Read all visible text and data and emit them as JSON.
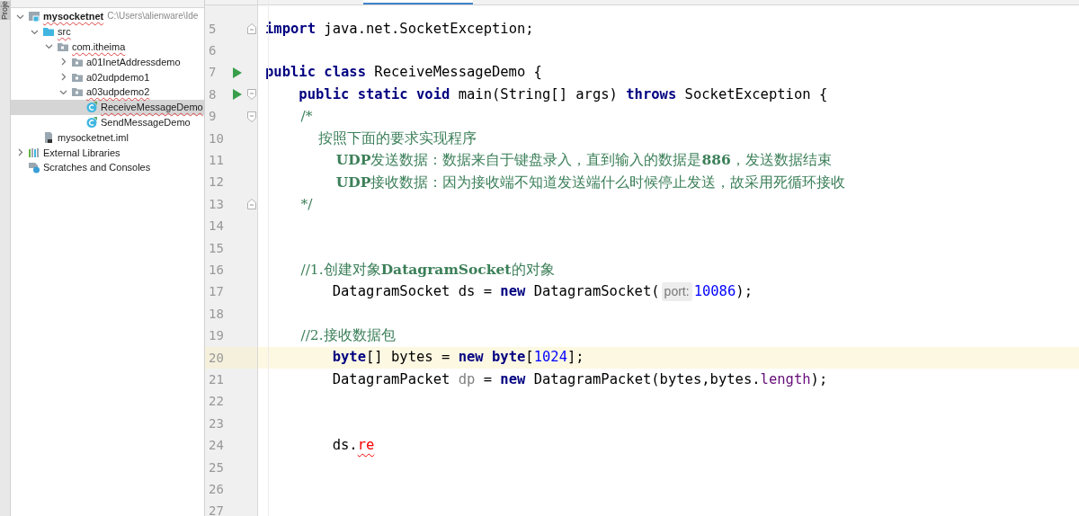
{
  "tool_window_stripe": {
    "label": "Proje"
  },
  "project_panel": {
    "tree": [
      {
        "label": "mysocketnet",
        "detail": "C:\\Users\\alienware\\Ide",
        "kind": "module",
        "expanded": true,
        "selected": false,
        "misspelled": true,
        "children": [
          {
            "label": "src",
            "kind": "source",
            "expanded": true,
            "selected": false,
            "misspelled": true,
            "children": [
              {
                "label": "com.itheima",
                "kind": "package",
                "expanded": true,
                "selected": false,
                "misspelled": true,
                "children": [
                  {
                    "label": "a01InetAddressdemo",
                    "kind": "package",
                    "expanded": false,
                    "selected": false,
                    "misspelled": false
                  },
                  {
                    "label": "a02udpdemo1",
                    "kind": "package",
                    "expanded": false,
                    "selected": false,
                    "misspelled": false
                  },
                  {
                    "label": "a03udpdemo2",
                    "kind": "package",
                    "expanded": true,
                    "selected": false,
                    "misspelled": true,
                    "children": [
                      {
                        "label": "ReceiveMessageDemo",
                        "kind": "class",
                        "selected": true,
                        "misspelled": true
                      },
                      {
                        "label": "SendMessageDemo",
                        "kind": "class",
                        "selected": false,
                        "misspelled": false
                      }
                    ]
                  }
                ]
              }
            ]
          },
          {
            "label": "mysocketnet.iml",
            "kind": "file",
            "selected": false,
            "misspelled": false
          }
        ]
      },
      {
        "label": "External Libraries",
        "kind": "libraries",
        "expanded": false,
        "selected": false,
        "misspelled": false
      },
      {
        "label": "Scratches and Consoles",
        "kind": "scratches",
        "selected": false,
        "misspelled": false
      }
    ]
  },
  "lines": [
    {
      "number": "5",
      "current": false,
      "run": false,
      "fold_start": false,
      "fold_end": true,
      "tokens": [
        {
          "kind": "keyword",
          "text": "import"
        },
        {
          "kind": "plain",
          "text": " java.net.SocketException;"
        }
      ]
    },
    {
      "number": "6",
      "current": false,
      "run": false,
      "fold_start": false,
      "fold_end": false
    },
    {
      "number": "7",
      "current": false,
      "run": true,
      "fold_start": false,
      "fold_end": false,
      "tokens": [
        {
          "kind": "keyword",
          "text": "public class"
        },
        {
          "kind": "plain",
          "text": " ReceiveMessageDemo {"
        }
      ]
    },
    {
      "number": "8",
      "current": false,
      "run": true,
      "fold_start": true,
      "fold_end": false,
      "tokens": [
        {
          "kind": "keyword",
          "text": "    public static void"
        },
        {
          "kind": "plain",
          "text": " main(String[] args) "
        },
        {
          "kind": "keyword",
          "text": "throws"
        },
        {
          "kind": "plain",
          "text": " SocketException {"
        }
      ]
    },
    {
      "number": "9",
      "current": false,
      "run": false,
      "fold_start": true,
      "fold_end": false,
      "tokens": [
        {
          "kind": "comment",
          "text": "        /*"
        }
      ]
    },
    {
      "number": "10",
      "current": false,
      "run": false,
      "fold_start": false,
      "fold_end": false,
      "tokens": [
        {
          "kind": "comment",
          "text": "            按照下面的要求实现程序"
        }
      ]
    },
    {
      "number": "11",
      "current": false,
      "run": false,
      "fold_start": false,
      "fold_end": false,
      "tokens": [
        {
          "kind": "comment",
          "text": "                **UDP**发送数据：数据来自于键盘录入，直到输入的数据是**886**，发送数据结束"
        }
      ]
    },
    {
      "number": "12",
      "current": false,
      "run": false,
      "fold_start": false,
      "fold_end": false,
      "tokens": [
        {
          "kind": "comment",
          "text": "                **UDP**接收数据：因为接收端不知道发送端什么时候停止发送，故采用死循环接收"
        }
      ]
    },
    {
      "number": "13",
      "current": false,
      "run": false,
      "fold_start": false,
      "fold_end": true,
      "tokens": [
        {
          "kind": "comment",
          "text": "        */"
        }
      ]
    },
    {
      "number": "14",
      "current": false,
      "run": false,
      "fold_start": false,
      "fold_end": false
    },
    {
      "number": "15",
      "current": false,
      "run": false,
      "fold_start": false,
      "fold_end": false
    },
    {
      "number": "16",
      "current": false,
      "run": false,
      "fold_start": false,
      "fold_end": false,
      "tokens": [
        {
          "kind": "comment",
          "text": "        //1.创建对象**DatagramSocket**的对象"
        }
      ]
    },
    {
      "number": "17",
      "current": false,
      "run": false,
      "fold_start": false,
      "fold_end": false,
      "tokens": [
        {
          "kind": "plain",
          "text": "        DatagramSocket ds = "
        },
        {
          "kind": "keyword",
          "text": "new"
        },
        {
          "kind": "plain",
          "text": " DatagramSocket("
        },
        {
          "kind": "hint",
          "text": "port:"
        },
        {
          "kind": "number",
          "text": "10086"
        },
        {
          "kind": "plain",
          "text": ");"
        }
      ]
    },
    {
      "number": "18",
      "current": false,
      "run": false,
      "fold_start": false,
      "fold_end": false
    },
    {
      "number": "19",
      "current": false,
      "run": false,
      "fold_start": false,
      "fold_end": false,
      "tokens": [
        {
          "kind": "comment",
          "text": "        //2.接收数据包"
        }
      ]
    },
    {
      "number": "20",
      "current": true,
      "run": false,
      "fold_start": false,
      "fold_end": false,
      "tokens": [
        {
          "kind": "keyword",
          "text": "        byte"
        },
        {
          "kind": "plain",
          "text": "[] bytes = "
        },
        {
          "kind": "keyword",
          "text": "new byte"
        },
        {
          "kind": "plain",
          "text": "["
        },
        {
          "kind": "number",
          "text": "1024"
        },
        {
          "kind": "plain",
          "text": "];"
        }
      ]
    },
    {
      "number": "21",
      "current": false,
      "run": false,
      "fold_start": false,
      "fold_end": false,
      "tokens": [
        {
          "kind": "plain",
          "text": "        DatagramPacket "
        },
        {
          "kind": "unused",
          "text": "dp"
        },
        {
          "kind": "plain",
          "text": " = "
        },
        {
          "kind": "keyword",
          "text": "new"
        },
        {
          "kind": "plain",
          "text": " DatagramPacket(bytes,bytes."
        },
        {
          "kind": "field",
          "text": "length"
        },
        {
          "kind": "plain",
          "text": ");"
        }
      ]
    },
    {
      "number": "22",
      "current": false,
      "run": false,
      "fold_start": false,
      "fold_end": false
    },
    {
      "number": "23",
      "current": false,
      "run": false,
      "fold_start": false,
      "fold_end": false
    },
    {
      "number": "24",
      "current": false,
      "run": false,
      "fold_start": false,
      "fold_end": false,
      "tokens": [
        {
          "kind": "plain",
          "text": "        ds."
        },
        {
          "kind": "error",
          "text": "re"
        }
      ]
    },
    {
      "number": "25",
      "current": false,
      "run": false,
      "fold_start": false,
      "fold_end": false
    },
    {
      "number": "26",
      "current": false,
      "run": false,
      "fold_start": false,
      "fold_end": false
    },
    {
      "number": "27",
      "current": false,
      "run": false,
      "fold_start": false,
      "fold_end": false
    }
  ]
}
